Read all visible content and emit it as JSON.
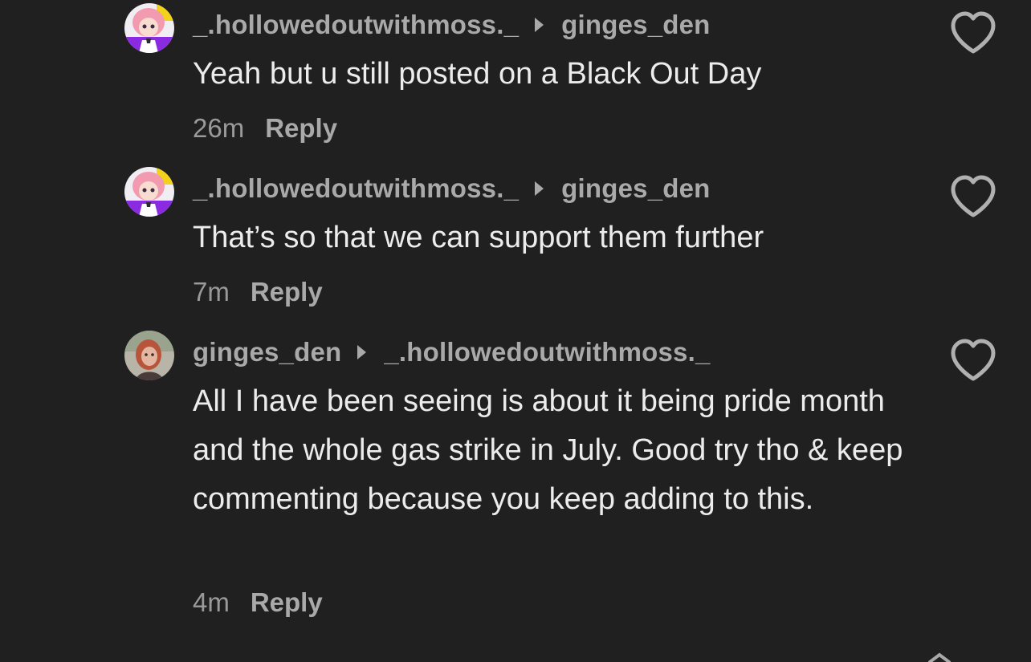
{
  "comments": [
    {
      "author": "_.hollowedoutwithmoss._",
      "reply_to": "ginges_den",
      "text": "Yeah but u still posted on a Black Out Day",
      "age": "26m",
      "reply_label": "Reply",
      "avatar_icon": "anime-avatar-icon"
    },
    {
      "author": "_.hollowedoutwithmoss._",
      "reply_to": "ginges_den",
      "text": "That’s so that we can support them further",
      "age": "7m",
      "reply_label": "Reply",
      "avatar_icon": "anime-avatar-icon"
    },
    {
      "author": "ginges_den",
      "reply_to": "_.hollowedoutwithmoss._",
      "text": "All I have been seeing is about it being pride month and the whole gas strike in July. Good try tho & keep commenting because you keep adding to this.",
      "age": "4m",
      "reply_label": "Reply",
      "avatar_icon": "photo-avatar-icon"
    }
  ],
  "icons": {
    "like": "heart-outline-icon",
    "reply_indicator": "caret-right-icon"
  },
  "colors": {
    "background": "#202020",
    "username": "#a9a9a9",
    "comment_text": "#ececec",
    "meta_text": "#9a9a9a"
  }
}
